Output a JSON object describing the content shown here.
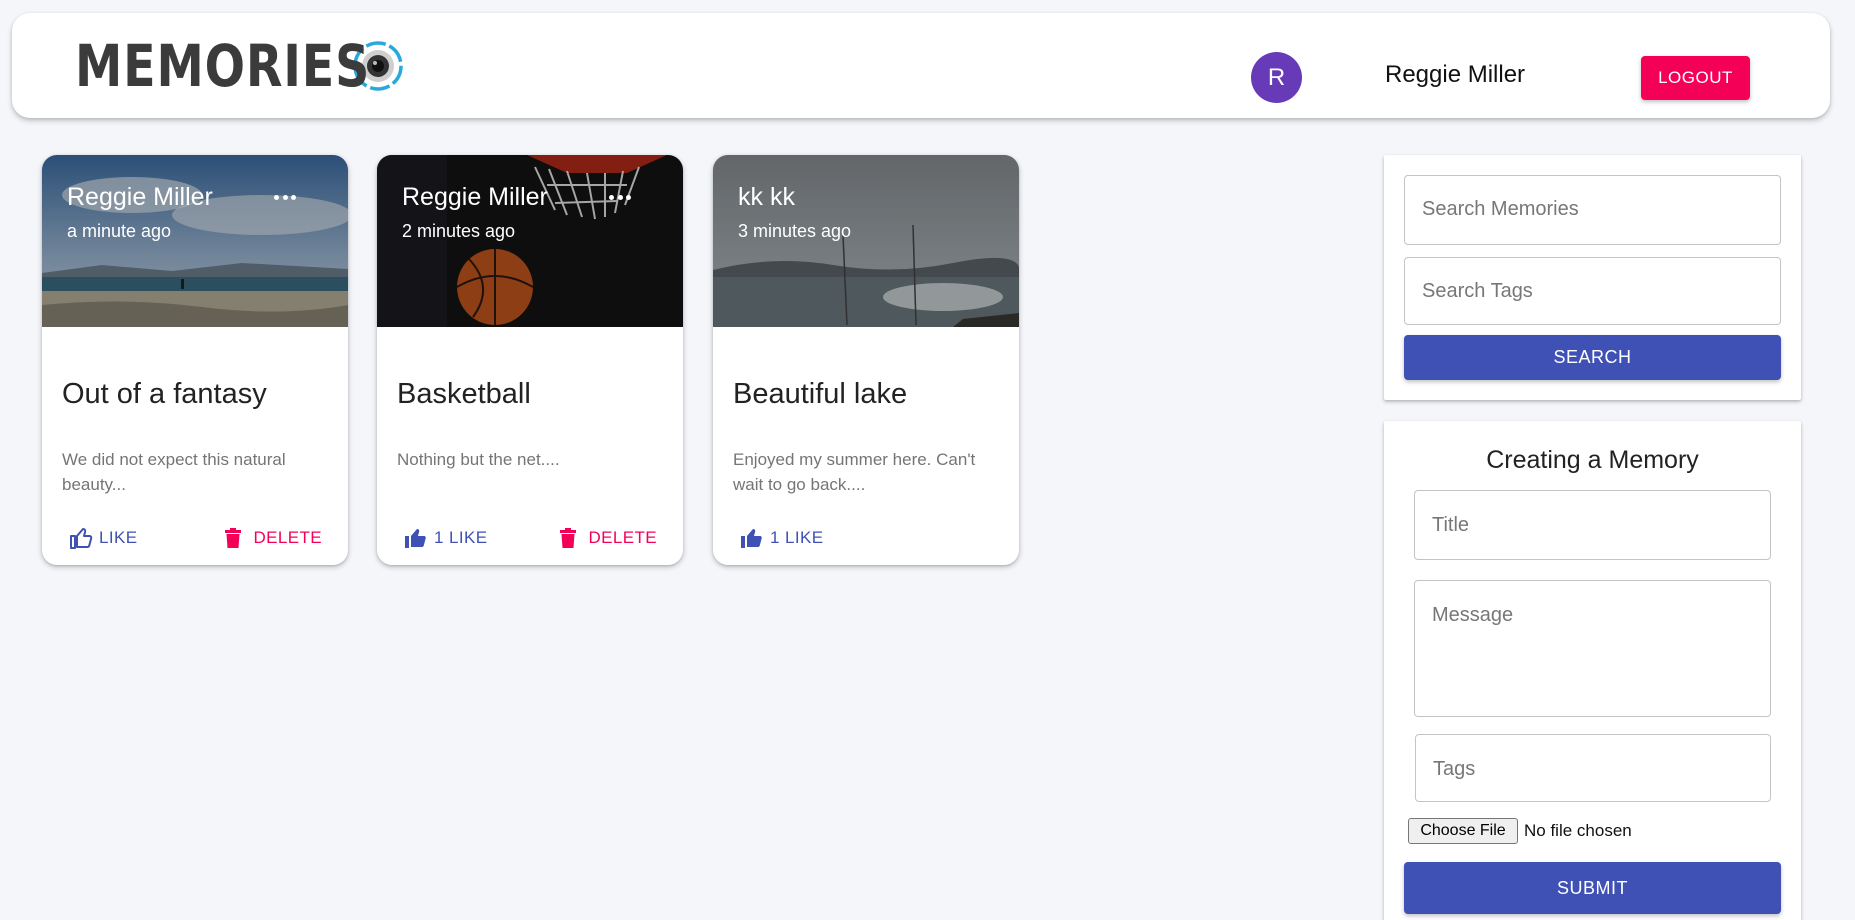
{
  "header": {
    "brand": "MEMORIES",
    "avatar_initial": "R",
    "username": "Reggie Miller",
    "logout_label": "LOGOUT"
  },
  "posts": [
    {
      "author": "Reggie Miller",
      "time": "a minute ago",
      "title": "Out of a fantasy",
      "message": "We did not expect this natural beauty...",
      "like_label": "LIKE",
      "delete_label": "DELETE"
    },
    {
      "author": "Reggie Miller",
      "time": "2 minutes ago",
      "title": "Basketball",
      "message": "Nothing but the net....",
      "like_label": "1 LIKE",
      "delete_label": "DELETE"
    },
    {
      "author": "kk kk",
      "time": "3 minutes ago",
      "title": "Beautiful lake",
      "message": "Enjoyed my summer here. Can't wait to go back....",
      "like_label": "1 LIKE"
    }
  ],
  "search": {
    "memories_placeholder": "Search Memories",
    "tags_placeholder": "Search Tags",
    "button_label": "SEARCH"
  },
  "form": {
    "title": "Creating a Memory",
    "title_placeholder": "Title",
    "message_placeholder": "Message",
    "tags_placeholder": "Tags",
    "file_button_label": "Choose File",
    "file_status": "No file chosen",
    "submit_label": "SUBMIT"
  },
  "colors": {
    "primary": "#3f51b5",
    "secondary": "#f50057",
    "avatar": "#673ab7",
    "background": "#f5f6fa"
  }
}
